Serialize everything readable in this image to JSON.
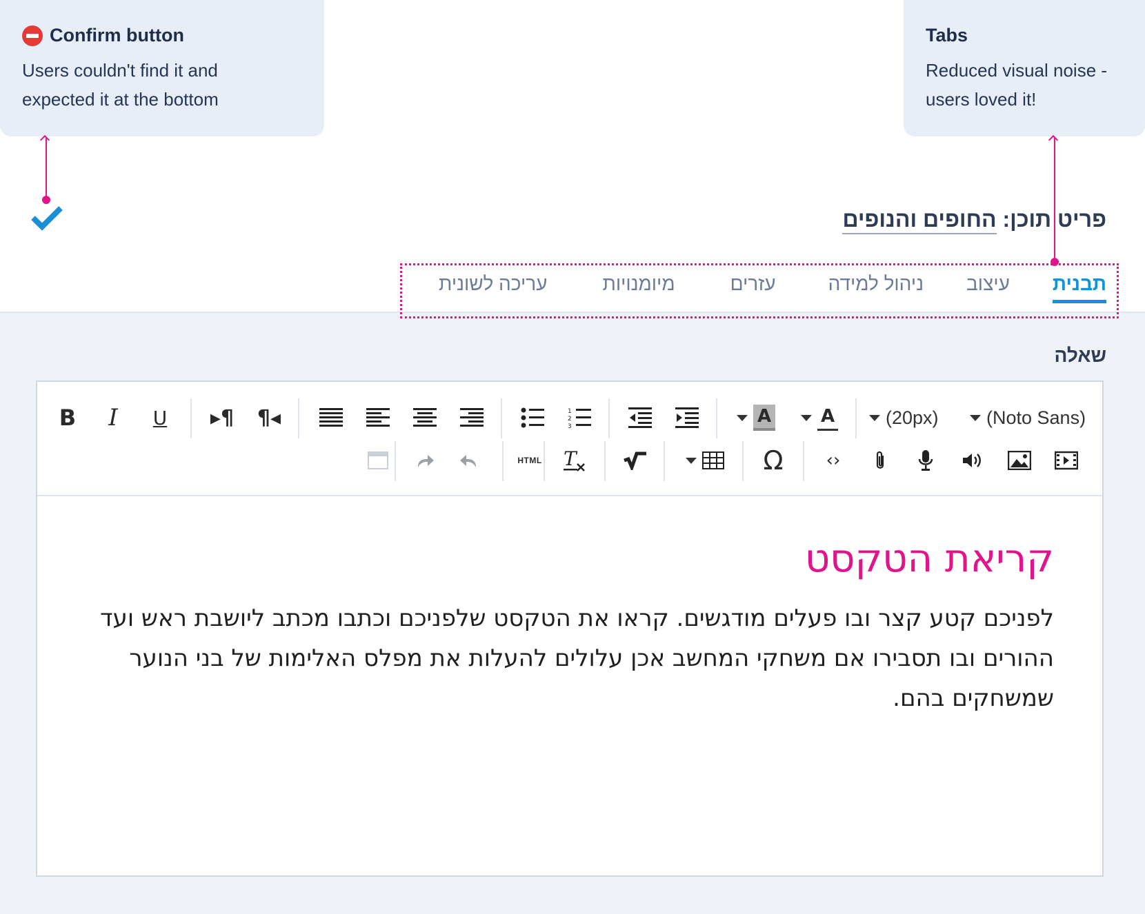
{
  "callouts": {
    "confirm": {
      "title": "Confirm button",
      "body_line1": "Users couldn't find it and",
      "body_line2": "expected it at the bottom"
    },
    "tabs": {
      "title": "Tabs",
      "body_line1": "Reduced visual noise -",
      "body_line2": "users loved it!"
    }
  },
  "header": {
    "title_prefix": "פריט תוכן:",
    "title_link": "החופים והנופים"
  },
  "tabs": [
    {
      "label": "תבנית",
      "active": true
    },
    {
      "label": "עיצוב",
      "active": false
    },
    {
      "label": "ניהול למידה",
      "active": false
    },
    {
      "label": "עזרים",
      "active": false
    },
    {
      "label": "מיומנויות",
      "active": false
    },
    {
      "label": "עריכה לשונית",
      "active": false
    }
  ],
  "question": {
    "label": "שאלה"
  },
  "toolbar": {
    "font_size": "(20px)",
    "font_family": "(Noto Sans)",
    "html_label": "HTML"
  },
  "editor": {
    "heading": "קריאת הטקסט",
    "paragraph": "לפניכם קטע קצר ובו פעלים מודגשים. קראו את הטקסט שלפניכם וכתבו מכתב ליושבת ראש ועד ההורים ובו תסבירו אם משחקי המחשב אכן עלולים להעלות את מפלס האלימות של בני הנוער שמשחקים בהם."
  },
  "colors": {
    "accent_pink": "#e0158c",
    "active_tab_blue": "#1292d9",
    "confirm_check_blue": "#1a8fd6",
    "error_red": "#e53935"
  }
}
